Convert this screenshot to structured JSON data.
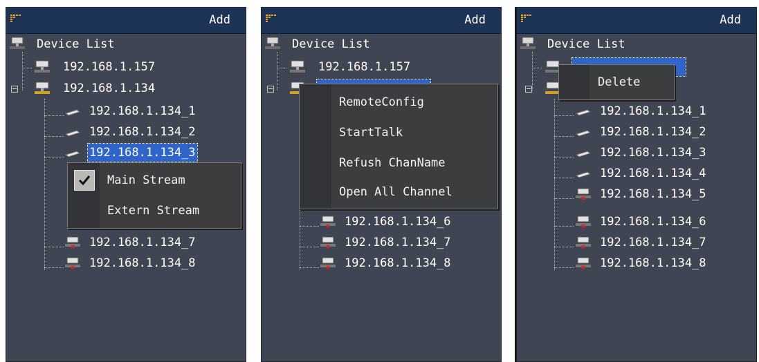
{
  "panels": [
    {
      "header": {
        "add_label": "Add"
      },
      "tree": {
        "root_label": "Device List",
        "devices": [
          {
            "label": "192.168.1.157"
          },
          {
            "label": "192.168.1.134"
          }
        ],
        "channels": [
          "192.168.1.134_1",
          "192.168.1.134_2",
          "192.168.1.134_3",
          "192.168.1.134_7",
          "192.168.1.134_8"
        ],
        "selected_channel": "192.168.1.134_3"
      },
      "context_menu": {
        "items": [
          {
            "label": "Main Stream",
            "checked": true
          },
          {
            "label": "Extern Stream",
            "checked": false
          }
        ]
      }
    },
    {
      "header": {
        "add_label": "Add"
      },
      "tree": {
        "root_label": "Device List",
        "devices": [
          {
            "label": "192.168.1.157"
          }
        ],
        "channels": [
          "192.168.1.134_6",
          "192.168.1.134_7",
          "192.168.1.134_8"
        ]
      },
      "context_menu": {
        "items": [
          {
            "label": "RemoteConfig"
          },
          {
            "label": "StartTalk"
          },
          {
            "label": "Refush ChanName"
          },
          {
            "label": "Open All Channel"
          }
        ]
      }
    },
    {
      "header": {
        "add_label": "Add"
      },
      "tree": {
        "root_label": "Device List",
        "channels": [
          "192.168.1.134_1",
          "192.168.1.134_2",
          "192.168.1.134_3",
          "192.168.1.134_4",
          "192.168.1.134_5",
          "192.168.1.134_6",
          "192.168.1.134_7",
          "192.168.1.134_8"
        ]
      },
      "context_menu": {
        "items": [
          {
            "label": "Delete"
          }
        ]
      }
    }
  ],
  "colors": {
    "panel_bg": "#3f4553",
    "header_bg": "#1e3456",
    "selection": "#2f64c8",
    "menu_bg": "#3c3d3f"
  }
}
